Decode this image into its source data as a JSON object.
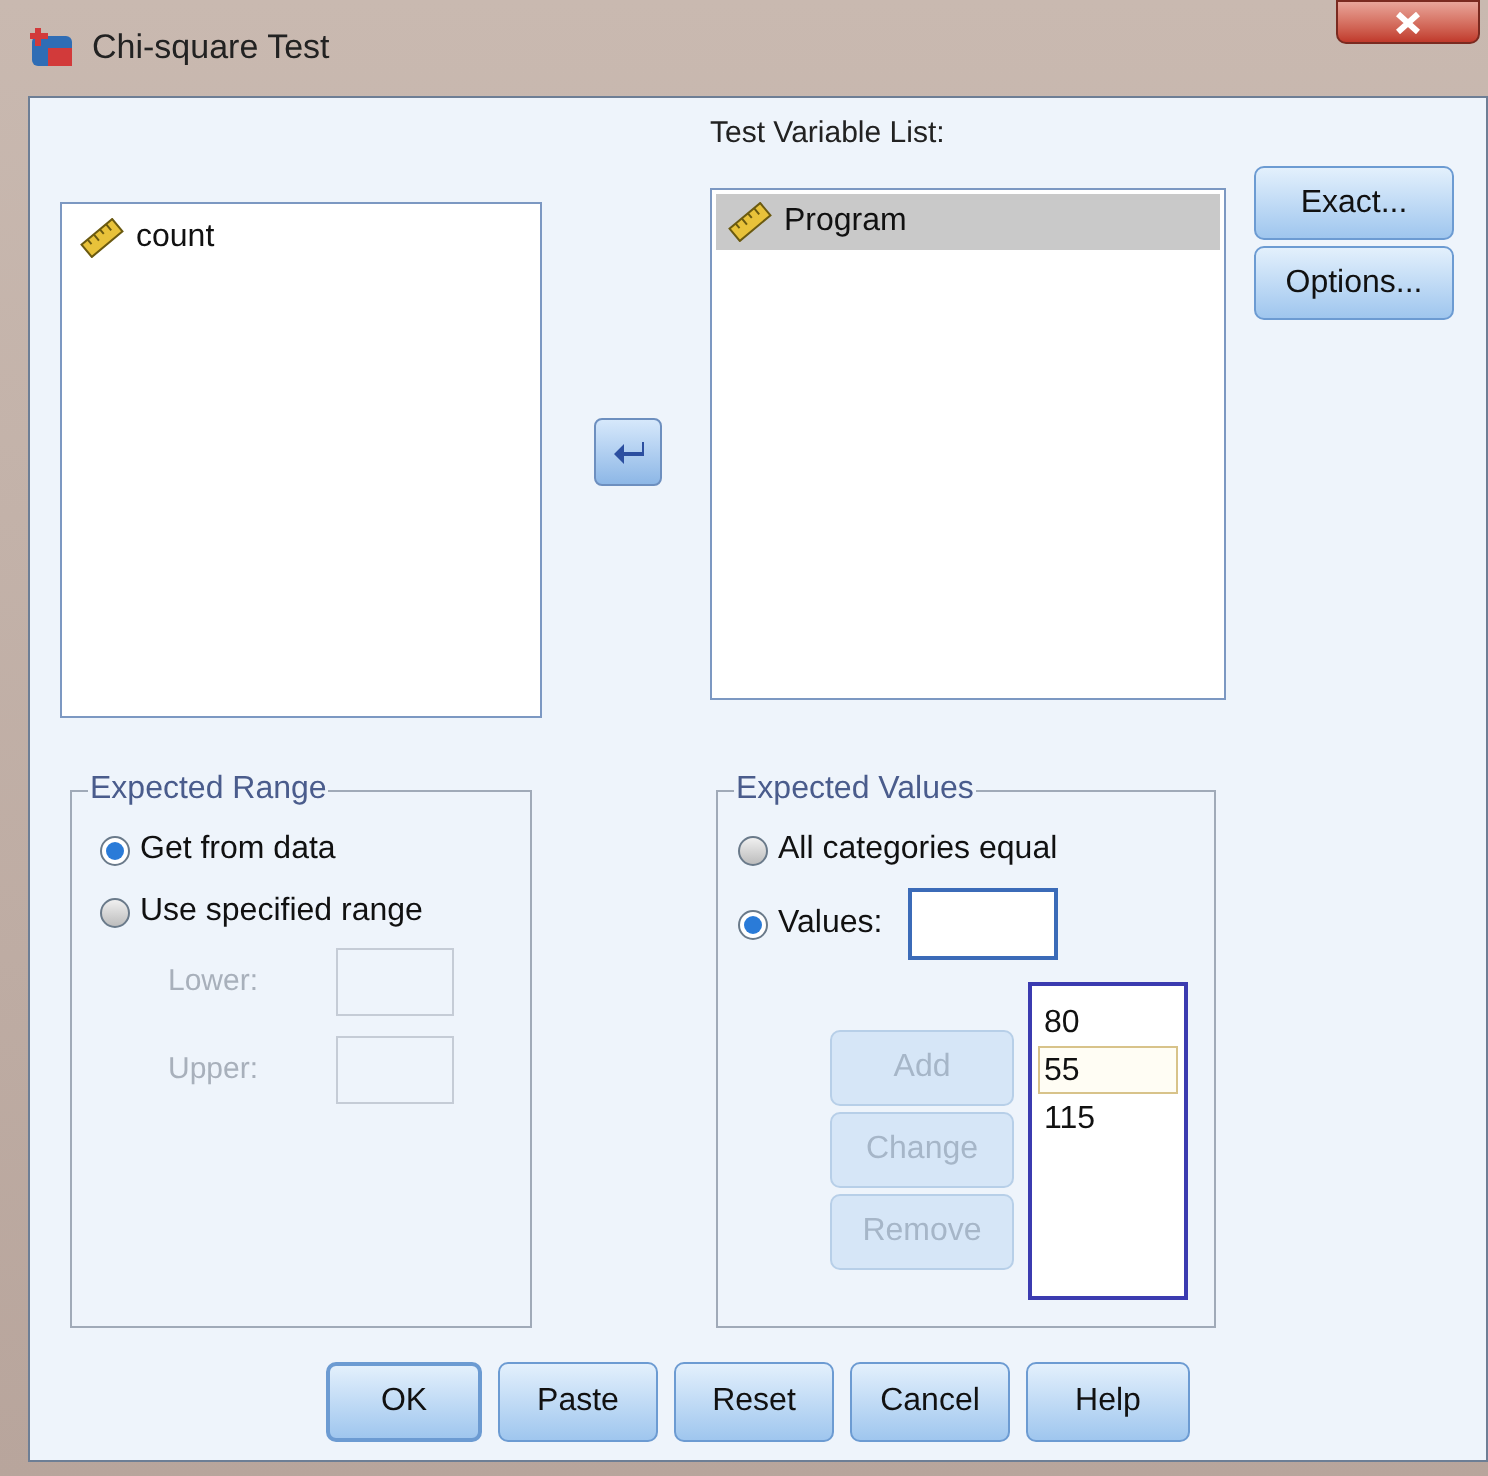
{
  "window": {
    "title": "Chi-square Test"
  },
  "source_list": {
    "items": [
      {
        "label": "count",
        "selected": false
      }
    ]
  },
  "test_variable_list": {
    "label": "Test Variable List:",
    "items": [
      {
        "label": "Program",
        "selected": true
      }
    ]
  },
  "side_buttons": [
    "Exact...",
    "Options..."
  ],
  "expected_range": {
    "title": "Expected Range",
    "options": [
      {
        "label": "Get from data",
        "selected": true
      },
      {
        "label": "Use specified range",
        "selected": false
      }
    ],
    "fields": [
      {
        "label": "Lower:",
        "disabled": true
      },
      {
        "label": "Upper:",
        "disabled": true
      }
    ]
  },
  "expected_values": {
    "title": "Expected Values",
    "options": [
      {
        "label": "All categories equal",
        "selected": false
      },
      {
        "label": "Values:",
        "selected": true
      }
    ],
    "buttons": [
      {
        "label": "Add",
        "disabled": true
      },
      {
        "label": "Change",
        "disabled": true
      },
      {
        "label": "Remove",
        "disabled": true
      }
    ],
    "values": [
      {
        "label": "80",
        "selected": false
      },
      {
        "label": "55",
        "selected": true
      },
      {
        "label": "115",
        "selected": false
      }
    ]
  },
  "buttons": [
    {
      "label": "OK",
      "default": true
    },
    {
      "label": "Paste",
      "default": false
    },
    {
      "label": "Reset",
      "default": false
    },
    {
      "label": "Cancel",
      "default": false
    },
    {
      "label": "Help",
      "default": false
    }
  ]
}
